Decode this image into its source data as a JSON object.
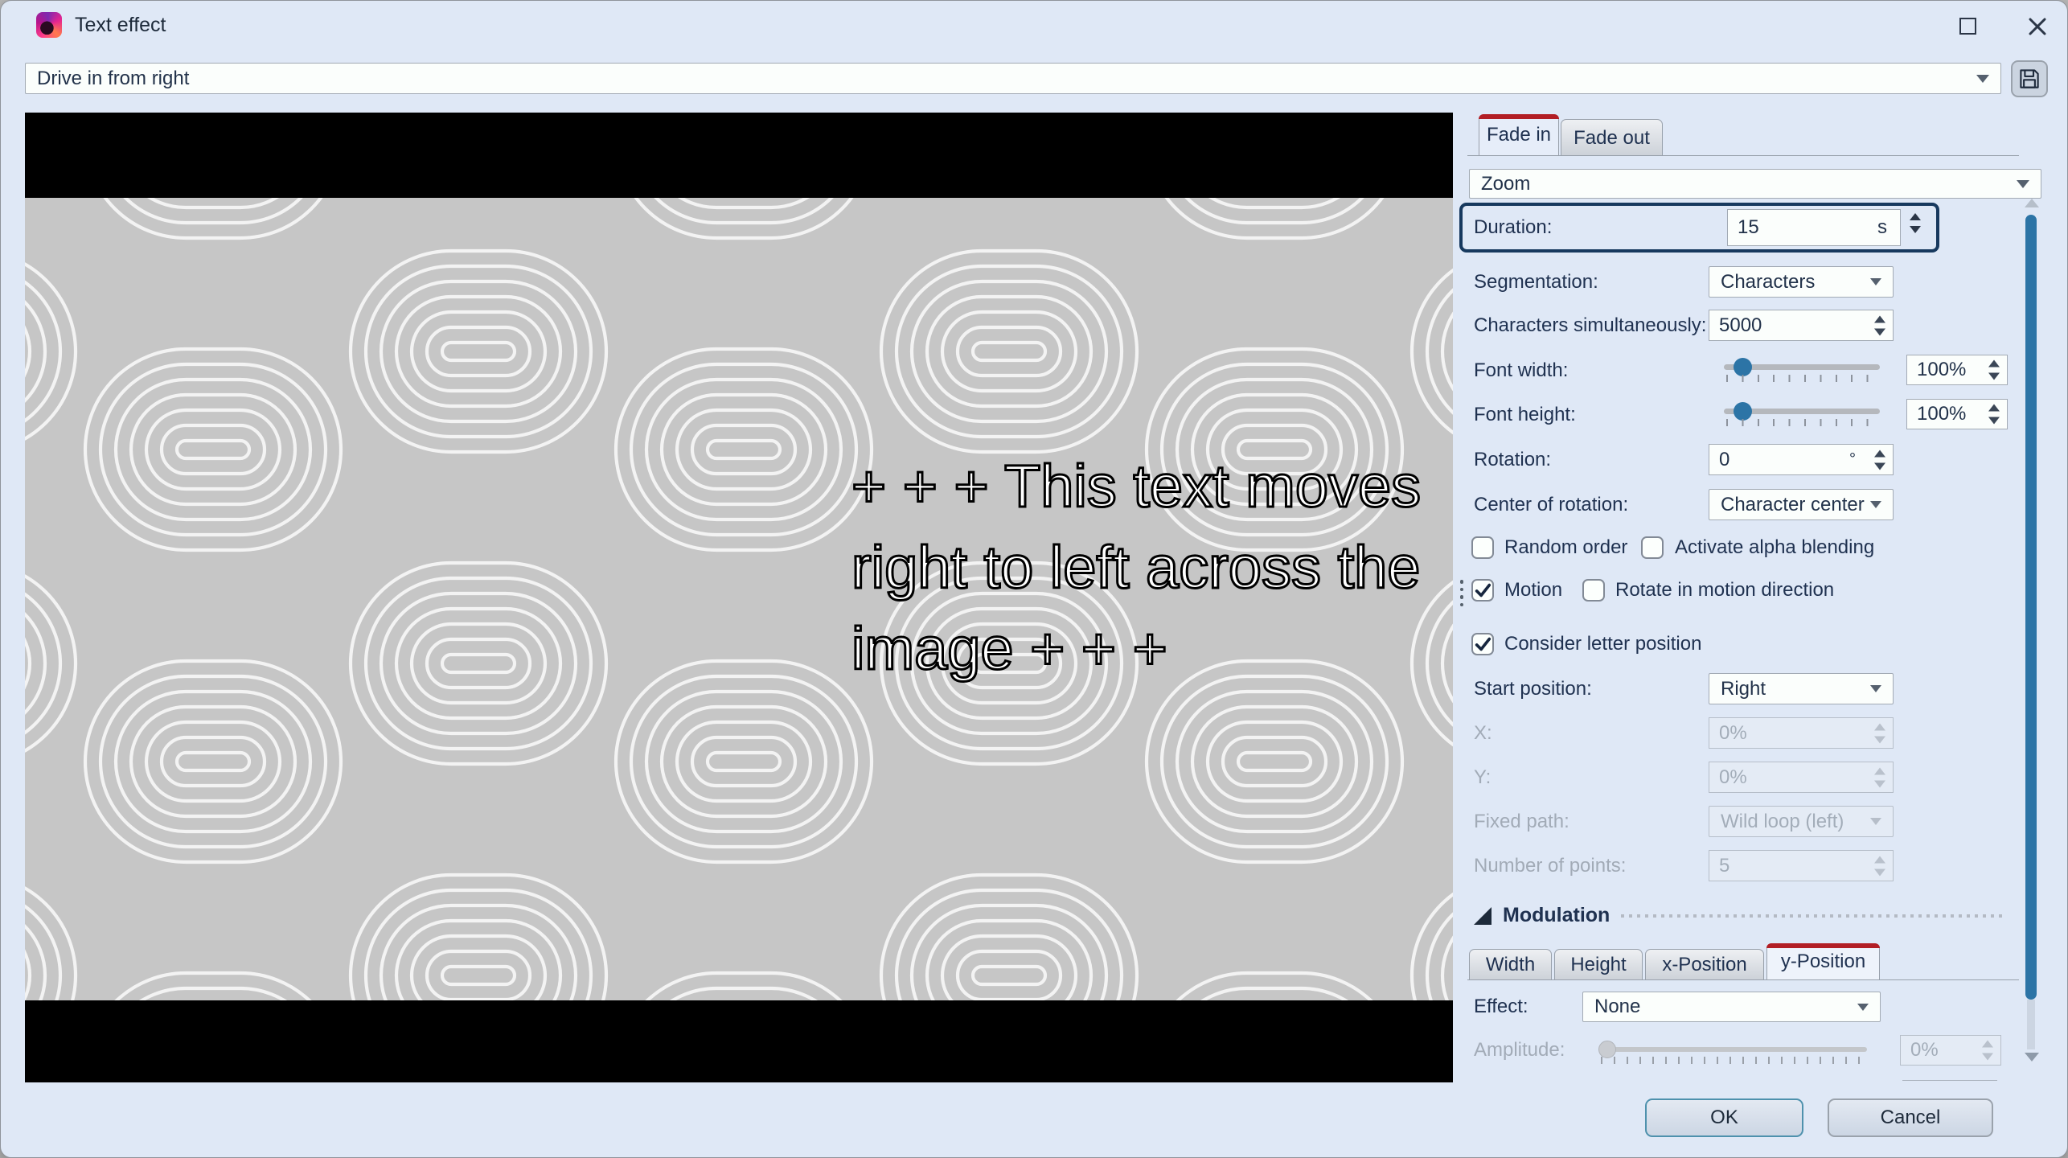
{
  "window": {
    "title": "Text effect"
  },
  "toolbar": {
    "preset_value": "Drive in from right"
  },
  "icons": {
    "app": "pink-swirl-logo",
    "save": "floppy-disk",
    "maximize": "square",
    "close": "x",
    "combo_arrow": "triangle-down",
    "spinner": "triangle-up-down",
    "check": "checkmark",
    "modulation_collapse": "corner-triangle",
    "splitter": "vertical-dots"
  },
  "colors": {
    "accent_red": "#b21e25",
    "focus_border": "#17395e",
    "slider_thumb": "#2c74a6",
    "scrollbar_thumb": "#2c74a6",
    "ok_border": "#4e91ad",
    "panel_bg": "#dfe8f6"
  },
  "preview": {
    "lines": [
      "+ + + This text moves",
      "right to left across the",
      "image + + +"
    ]
  },
  "panel": {
    "tabs": {
      "fade_in": "Fade in",
      "fade_out": "Fade out"
    },
    "type_combo": "Zoom",
    "duration": {
      "label": "Duration:",
      "value": "15",
      "unit": "s"
    },
    "segmentation": {
      "label": "Segmentation:",
      "value": "Characters"
    },
    "chars_simul": {
      "label": "Characters simultaneously:",
      "value": "5000"
    },
    "font_width": {
      "label": "Font width:",
      "value": "100%"
    },
    "font_height": {
      "label": "Font height:",
      "value": "100%"
    },
    "rotation": {
      "label": "Rotation:",
      "value": "0",
      "unit": "°"
    },
    "center_rotation": {
      "label": "Center of rotation:",
      "value": "Character center"
    },
    "random_order": "Random order",
    "alpha_blending": "Activate alpha blending",
    "motion": "Motion",
    "rotate_motion": "Rotate in motion direction",
    "consider_letter": "Consider letter position",
    "start_position": {
      "label": "Start position:",
      "value": "Right"
    },
    "x": {
      "label": "X:",
      "value": "0%"
    },
    "y": {
      "label": "Y:",
      "value": "0%"
    },
    "fixed_path": {
      "label": "Fixed path:",
      "value": "Wild loop (left)"
    },
    "num_points": {
      "label": "Number of points:",
      "value": "5"
    },
    "modulation": {
      "header": "Modulation",
      "tabs": [
        "Width",
        "Height",
        "x-Position",
        "y-Position"
      ],
      "effect": {
        "label": "Effect:",
        "value": "None"
      },
      "amplitude": {
        "label": "Amplitude:",
        "value": "0%"
      }
    }
  },
  "buttons": {
    "ok": "OK",
    "cancel": "Cancel"
  }
}
